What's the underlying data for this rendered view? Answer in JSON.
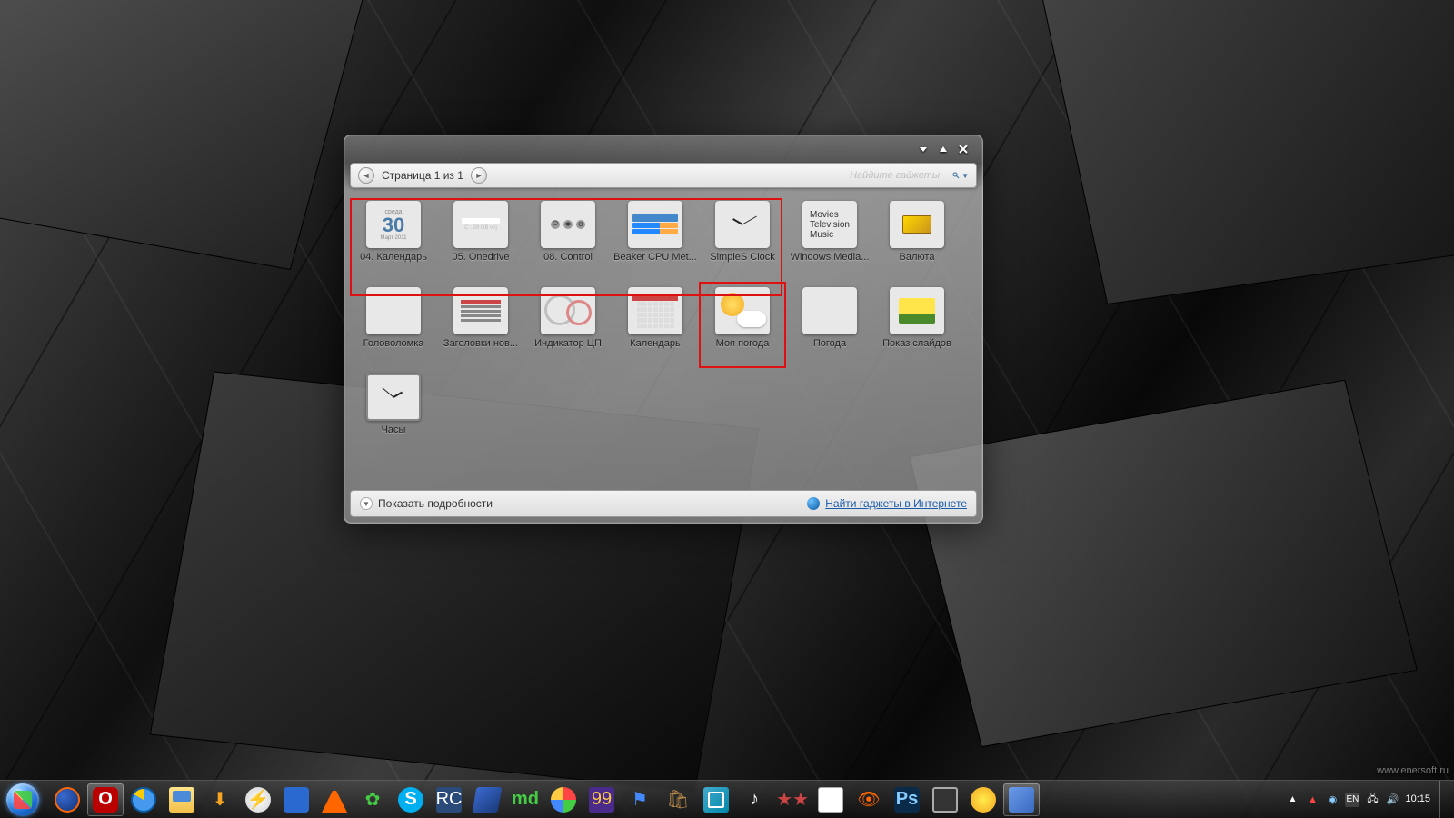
{
  "window": {
    "page_label": "Страница 1 из 1",
    "search_placeholder": "Найдите гаджеты",
    "details_label": "Показать подробности",
    "online_link": "Найти гаджеты в Интернете"
  },
  "cal_preview": {
    "dow": "среда",
    "day": "30",
    "month_year": "Март 2011"
  },
  "onedrive_preview": "C : 28 GB vrij",
  "wmc_preview": "Movies\nTelevision\nMusic",
  "gadgets": [
    {
      "label": "04. Календарь",
      "selected": true
    },
    {
      "label": "05. Onedrive"
    },
    {
      "label": "08. Control"
    },
    {
      "label": "Beaker CPU Met..."
    },
    {
      "label": "SimpleS Clock"
    },
    {
      "label": "Windows Media..."
    },
    {
      "label": "Валюта"
    },
    {
      "label": "Головоломка"
    },
    {
      "label": "Заголовки нов..."
    },
    {
      "label": "Индикатор ЦП"
    },
    {
      "label": "Календарь"
    },
    {
      "label": "Моя погода",
      "red": true
    },
    {
      "label": "Погода"
    },
    {
      "label": "Показ слайдов"
    },
    {
      "label": "Часы"
    }
  ],
  "taskbar": {
    "opera": "O",
    "skype": "S",
    "rc": "RC",
    "md": "md",
    "n99": "99",
    "ps": "Ps",
    "lang": "EN",
    "time": "10:15"
  },
  "watermark": "www.enersoft.ru"
}
